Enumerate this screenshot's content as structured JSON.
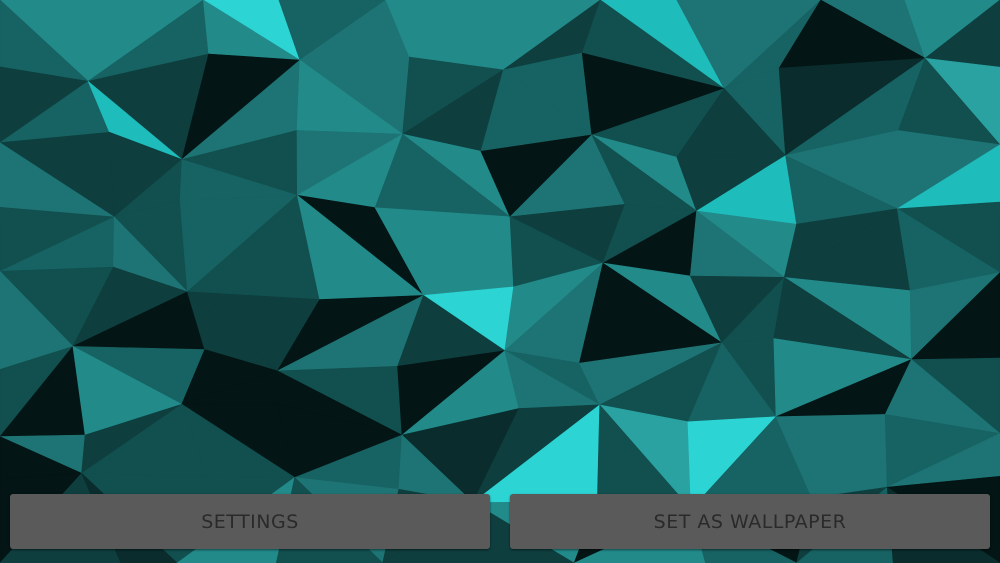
{
  "wallpaper": {
    "style": "low-poly teal triangles",
    "palette": [
      "#041515",
      "#0a2c2c",
      "#0e3e3e",
      "#124f4f",
      "#176262",
      "#1e7474",
      "#238a8a",
      "#2aa2a2",
      "#1fbcbc",
      "#2cd4d4"
    ]
  },
  "buttons": {
    "settings_label": "SETTINGS",
    "wallpaper_label": "SET AS WALLPAPER",
    "background_color": "#5a5a5a",
    "text_color": "#2a2a2a"
  }
}
